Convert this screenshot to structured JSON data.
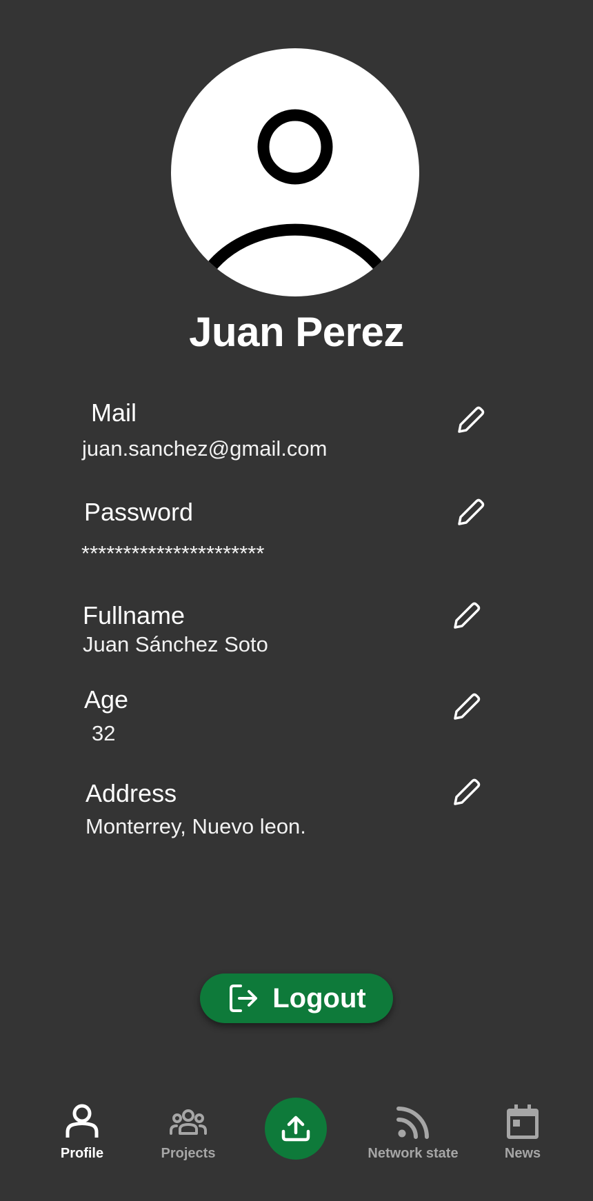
{
  "profile": {
    "name": "Juan Perez"
  },
  "fields": {
    "mail": {
      "label": "Mail",
      "value": "juan.sanchez@gmail.com"
    },
    "password": {
      "label": "Password",
      "value": "**********************"
    },
    "fullname": {
      "label": "Fullname",
      "value": "Juan Sánchez Soto"
    },
    "age": {
      "label": "Age",
      "value": "32"
    },
    "address": {
      "label": "Address",
      "value": "Monterrey, Nuevo leon."
    }
  },
  "logout": {
    "label": "Logout"
  },
  "nav": {
    "items": [
      {
        "label": "Profile",
        "icon": "person-icon",
        "active": true
      },
      {
        "label": "Projects",
        "icon": "group-icon",
        "active": false
      },
      {
        "label": "",
        "icon": "upload-icon",
        "active": false
      },
      {
        "label": "Network state",
        "icon": "rss-feed-icon",
        "active": false
      },
      {
        "label": "News",
        "icon": "calendar-icon",
        "active": false
      }
    ]
  },
  "colors": {
    "background": "#343434",
    "accent": "#0e7a3a",
    "inactive": "#a6a6a6",
    "text": "#ffffff"
  }
}
